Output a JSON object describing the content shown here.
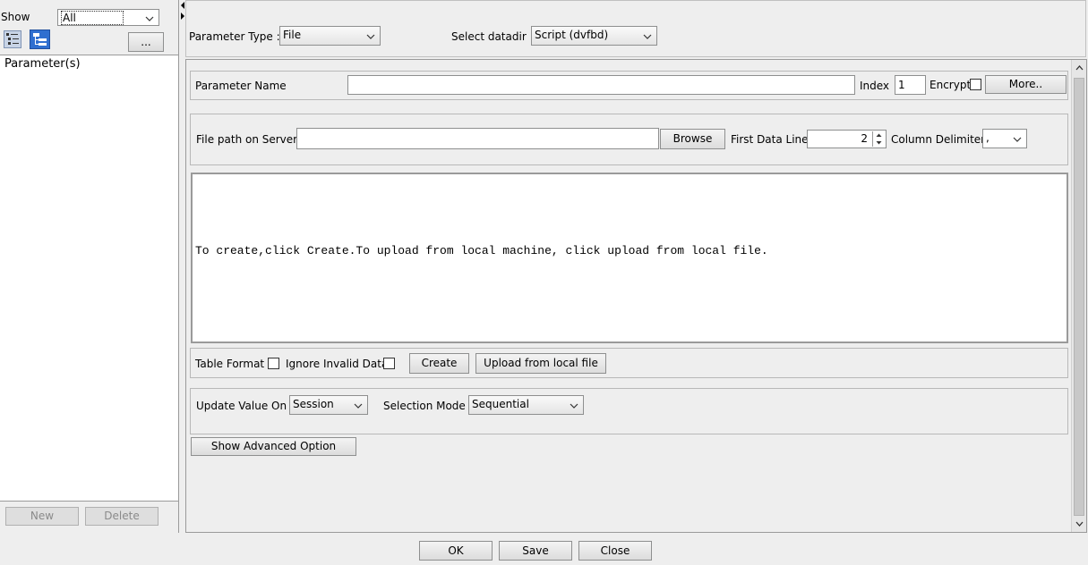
{
  "left_panel": {
    "show_label": "Show",
    "show_value": "All",
    "more_button": "...",
    "tree_root": "Parameter(s)",
    "new_button": "New",
    "delete_button": "Delete"
  },
  "top_bar": {
    "parameter_type_label": "Parameter Type :",
    "parameter_type_value": "File",
    "datadir_label": "Select datadir :",
    "datadir_value": "Script (dvfbd)"
  },
  "name_section": {
    "parameter_name_label": "Parameter Name",
    "parameter_name_value": "",
    "index_label": "Index",
    "index_value": "1",
    "encrypt_label": "Encrypt",
    "more_button": "More.."
  },
  "file_section": {
    "file_path_label": "File path on Server",
    "file_path_value": "",
    "browse_button": "Browse",
    "first_data_line_label": "First Data Line",
    "first_data_line_value": "2",
    "column_delimiter_label": "Column Delimiter",
    "column_delimiter_value": ","
  },
  "editor": {
    "hint_text": "To create,click Create.To upload from local machine, click upload from local file."
  },
  "format_section": {
    "table_format_label": "Table Format",
    "ignore_invalid_label": "Ignore Invalid Data",
    "create_button": "Create",
    "upload_button": "Upload from local file"
  },
  "update_section": {
    "update_value_on_label": "Update Value On",
    "update_value_on_value": "Session",
    "selection_mode_label": "Selection Mode",
    "selection_mode_value": "Sequential"
  },
  "advanced_button": "Show Advanced Option",
  "footer": {
    "ok_button": "OK",
    "save_button": "Save",
    "close_button": "Close"
  },
  "icons": {
    "tree_view_a": "list-tree-icon",
    "tree_view_b": "hierarchy-icon",
    "dropdown": "chevron-down-icon"
  }
}
